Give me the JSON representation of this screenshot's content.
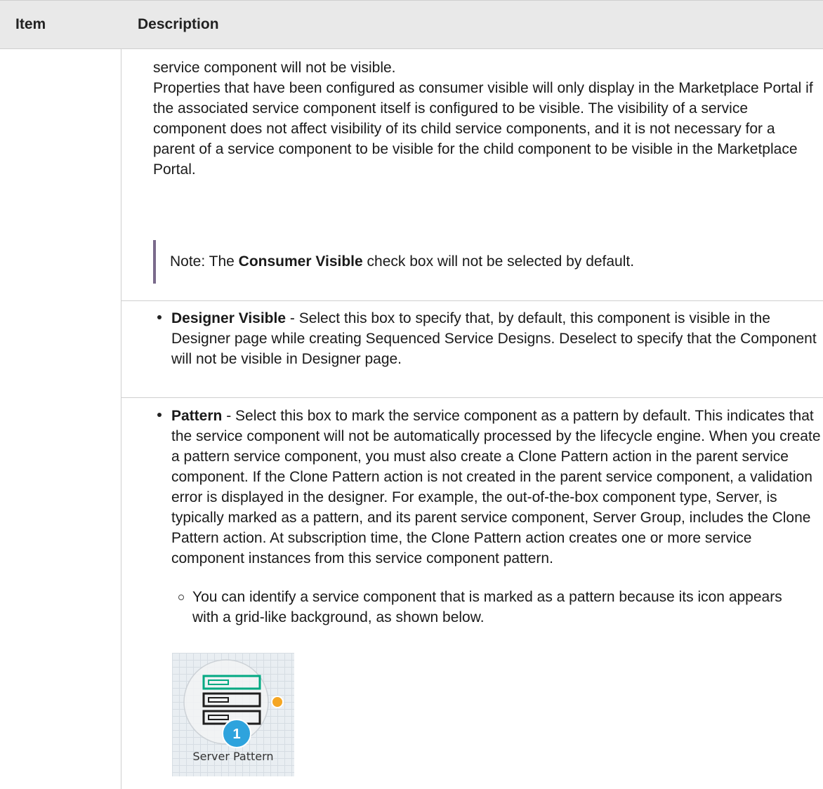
{
  "table": {
    "headers": {
      "item": "Item",
      "description": "Description"
    }
  },
  "content": {
    "line1": "service component will not be visible.",
    "para1": "Properties that have been configured as consumer visible will only display in the Marketplace Portal if the associated service component itself is configured to be visible. The visibility of a service component does not affect visibility of its child service components, and it is not necessary for a parent of a service component to be visible for the child component to be visible in the Marketplace Portal.",
    "note": {
      "prefix": "Note: The ",
      "bold": "Consumer Visible",
      "suffix": " check box will not be selected by default."
    },
    "bullets": [
      {
        "bold": "Designer Visible",
        "text": " - Select this box to specify that, by default, this component is visible in the Designer page while creating Sequenced Service Designs. Deselect to specify that the Component will not be visible in Designer page."
      },
      {
        "bold": "Pattern",
        "text": " - Select this box to mark the service component as a pattern by default. This indicates that the service component will not be automatically processed by the lifecycle engine. When you create a pattern service component, you must also create a Clone Pattern action in the parent service component. If the Clone Pattern action is not created in the parent service component, a validation error is displayed in the designer. For example, the out-of-the-box component type, Server, is typically marked as a pattern, and its parent service component, Server Group, includes the Clone Pattern action. At subscription time, the Clone Pattern action creates one or more service component instances from this service component pattern."
      }
    ],
    "sub_bullet": "You can identify a service component that is marked as a pattern because its icon appears with a grid-like background, as shown below.",
    "figure": {
      "label": "Server Pattern",
      "badge": "1",
      "icon": "server-pattern-icon",
      "colors": {
        "accent_green": "#01a982",
        "badge_blue": "#2ea3dd",
        "dot_orange": "#f5a623",
        "dark": "#1e1e1e"
      }
    }
  }
}
